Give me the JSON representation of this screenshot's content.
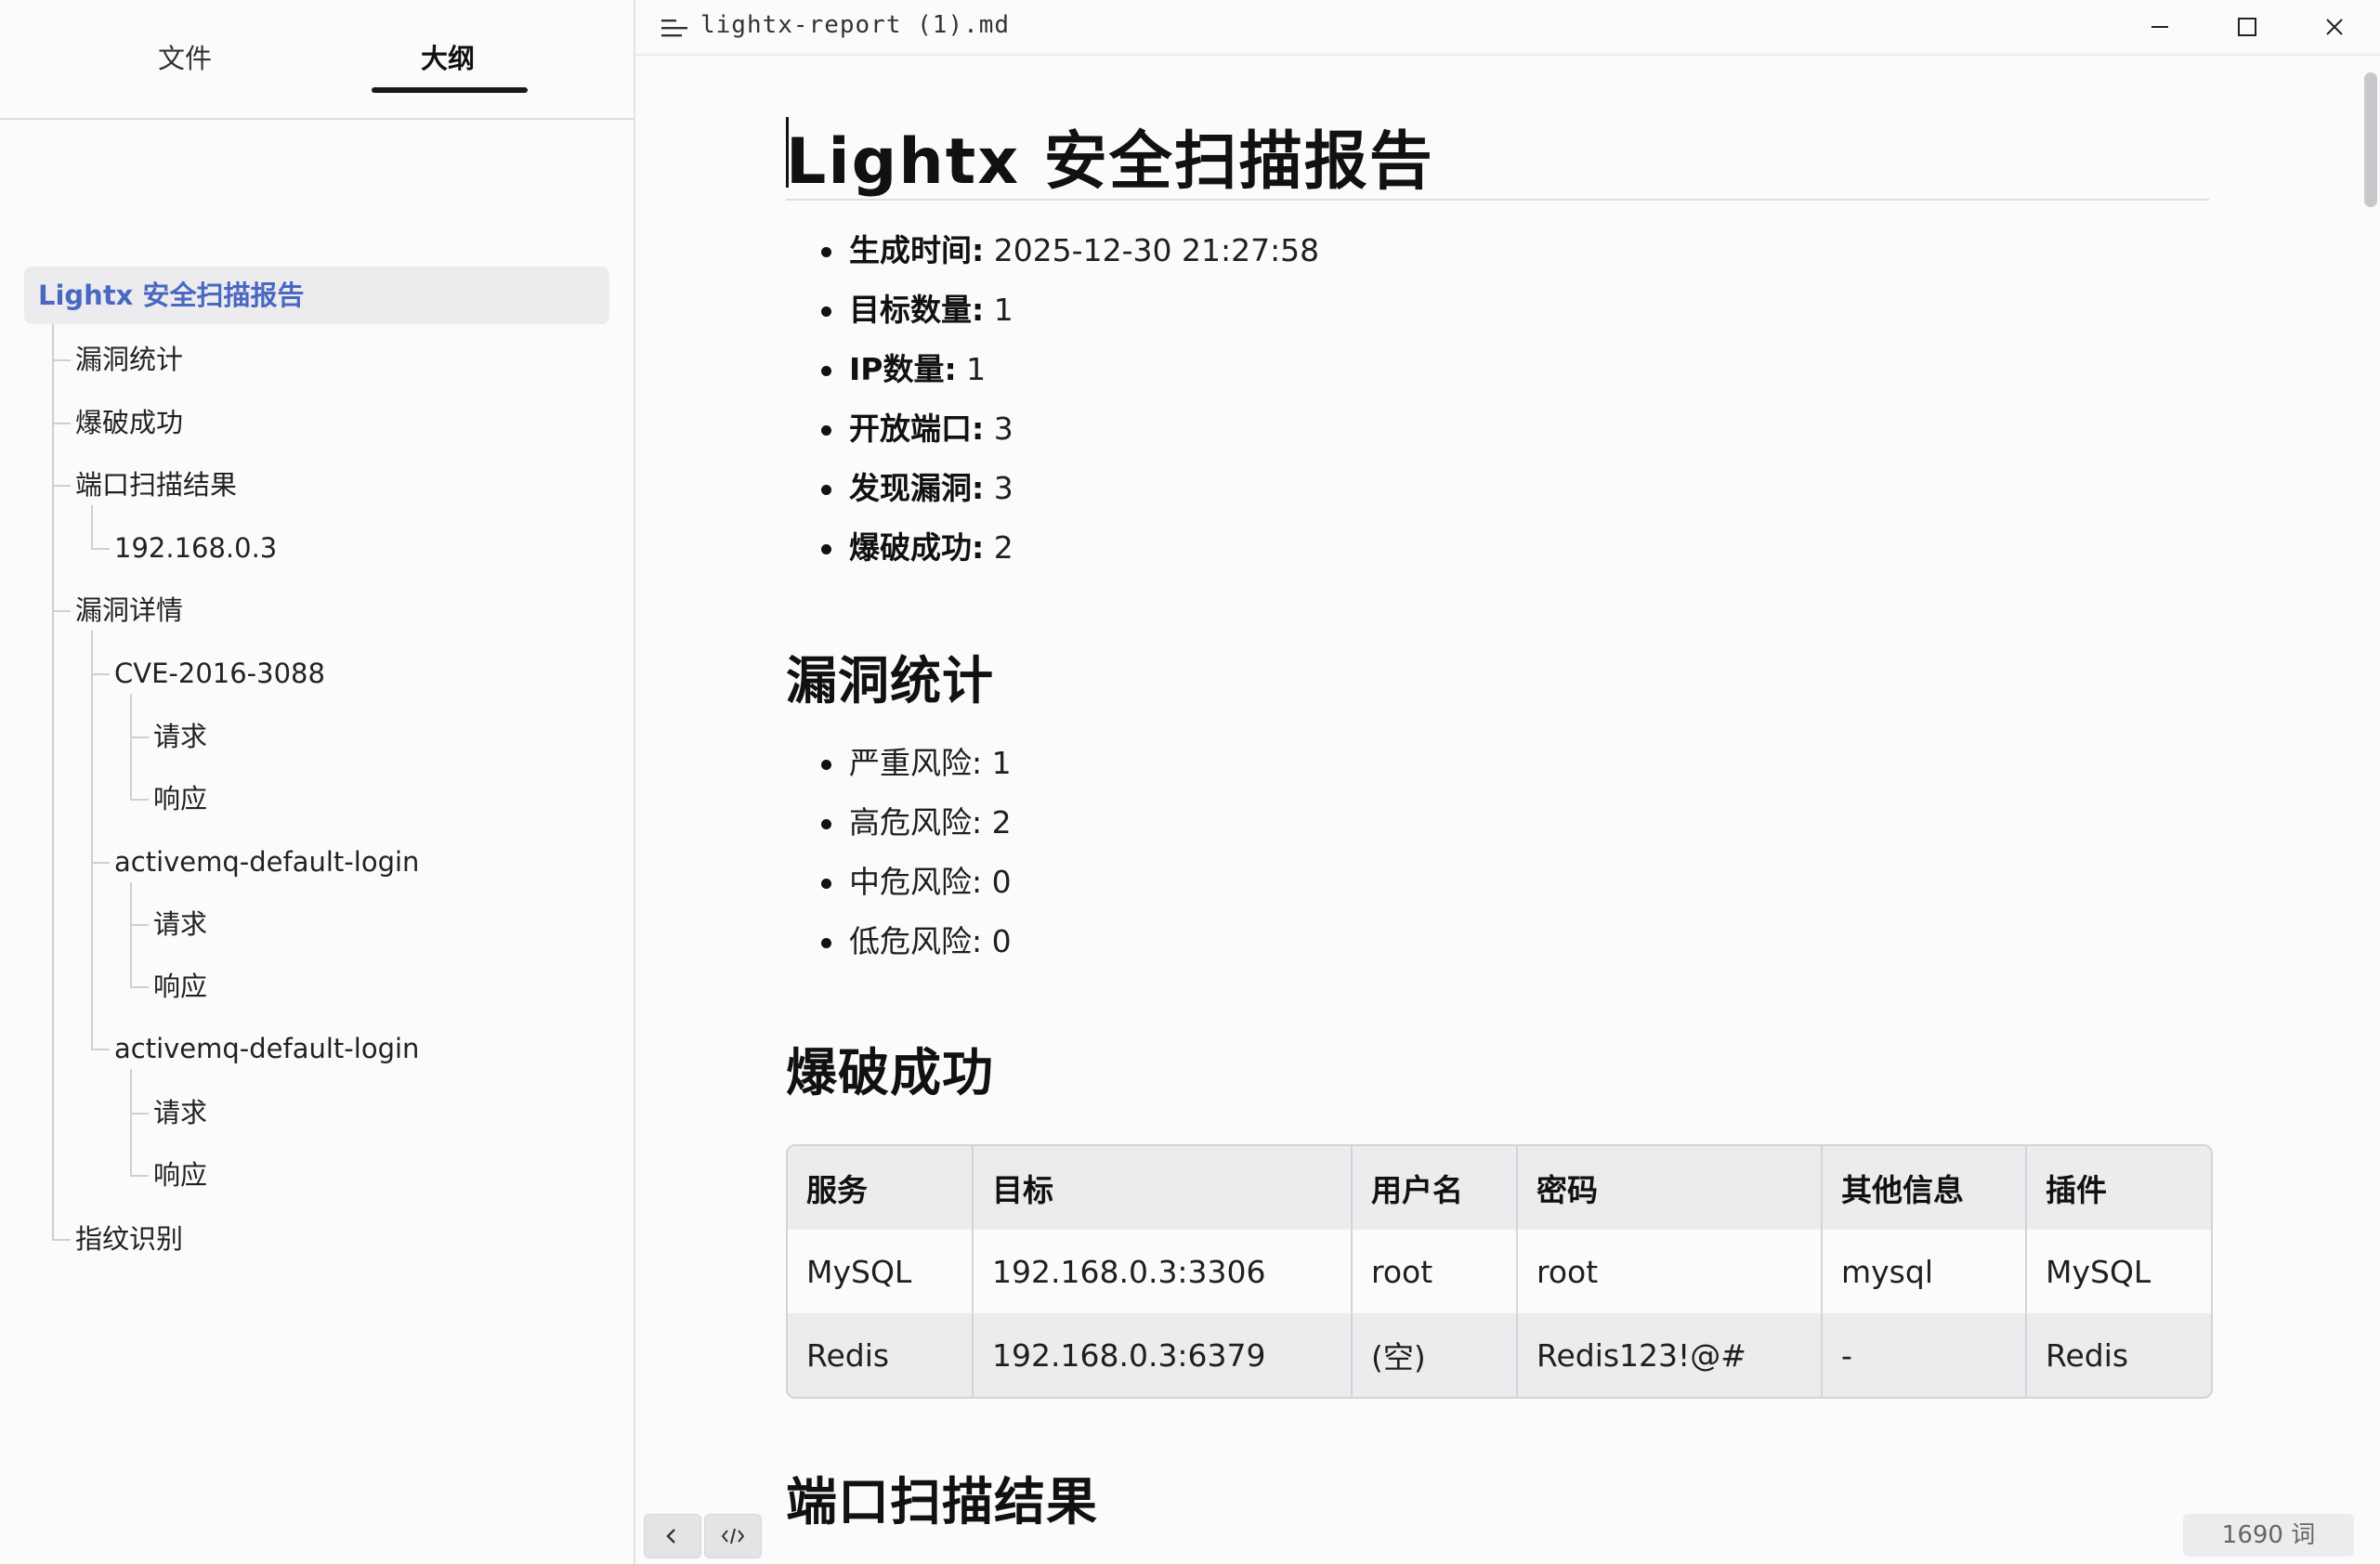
{
  "sidebar": {
    "tabs": [
      {
        "label": "文件"
      },
      {
        "label": "大纲"
      }
    ],
    "active_tab": "大纲",
    "outline": {
      "root": "Lightx 安全扫描报告",
      "items": [
        {
          "label": "漏洞统计"
        },
        {
          "label": "爆破成功"
        },
        {
          "label": "端口扫描结果"
        },
        {
          "label": "192.168.0.3"
        },
        {
          "label": "漏洞详情"
        },
        {
          "label": "CVE-2016-3088"
        },
        {
          "label": "请求"
        },
        {
          "label": "响应"
        },
        {
          "label": "activemq-default-login"
        },
        {
          "label": "请求"
        },
        {
          "label": "响应"
        },
        {
          "label": "activemq-default-login"
        },
        {
          "label": "请求"
        },
        {
          "label": "响应"
        },
        {
          "label": "指纹识别"
        }
      ]
    }
  },
  "titlebar": {
    "file_name": "lightx-report (1).md",
    "icons": [
      "menu-icon",
      "minimize-icon",
      "maximize-icon",
      "close-icon"
    ]
  },
  "document": {
    "title": "Lightx 安全扫描报告",
    "meta": [
      {
        "label": "生成时间:",
        "value": " 2025-12-30 21:27:58"
      },
      {
        "label": "目标数量:",
        "value": " 1"
      },
      {
        "label": "IP数量:",
        "value": " 1"
      },
      {
        "label": "开放端口:",
        "value": " 3"
      },
      {
        "label": "发现漏洞:",
        "value": " 3"
      },
      {
        "label": "爆破成功:",
        "value": " 2"
      }
    ],
    "section_vuln_stats": "漏洞统计",
    "stats": [
      {
        "text": "严重风险: 1"
      },
      {
        "text": "高危风险: 2"
      },
      {
        "text": "中危风险: 0"
      },
      {
        "text": "低危风险: 0"
      }
    ],
    "section_brute": "爆破成功",
    "brute_table": {
      "headers": [
        "服务",
        "目标",
        "用户名",
        "密码",
        "其他信息",
        "插件"
      ],
      "rows": [
        [
          "MySQL",
          "192.168.0.3:3306",
          "root",
          "root",
          "mysql",
          "MySQL"
        ],
        [
          "Redis",
          "192.168.0.3:6379",
          "(空)",
          "Redis123!@#",
          "-",
          "Redis"
        ]
      ]
    },
    "section_ports": "端口扫描结果"
  },
  "footer": {
    "word_count": "1690 词",
    "icons": [
      "chevron-left-icon",
      "code-icon"
    ]
  }
}
